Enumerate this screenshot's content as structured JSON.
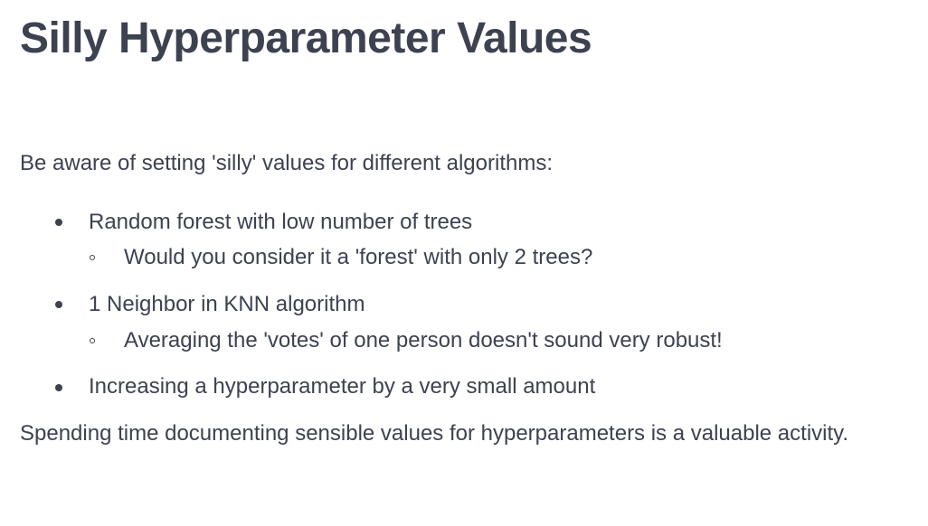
{
  "slide": {
    "title": "Silly Hyperparameter Values",
    "intro": "Be aware of setting 'silly' values for different algorithms:",
    "items": [
      {
        "text": "Random forest with low number of trees",
        "sub": "Would you consider it a 'forest' with only 2 trees?"
      },
      {
        "text": "1 Neighbor in KNN algorithm",
        "sub": "Averaging the 'votes' of one person doesn't sound very robust!"
      },
      {
        "text": "Increasing a hyperparameter by a very small amount"
      }
    ],
    "closing": "Spending time documenting sensible values for hyperparameters is a valuable activity."
  }
}
